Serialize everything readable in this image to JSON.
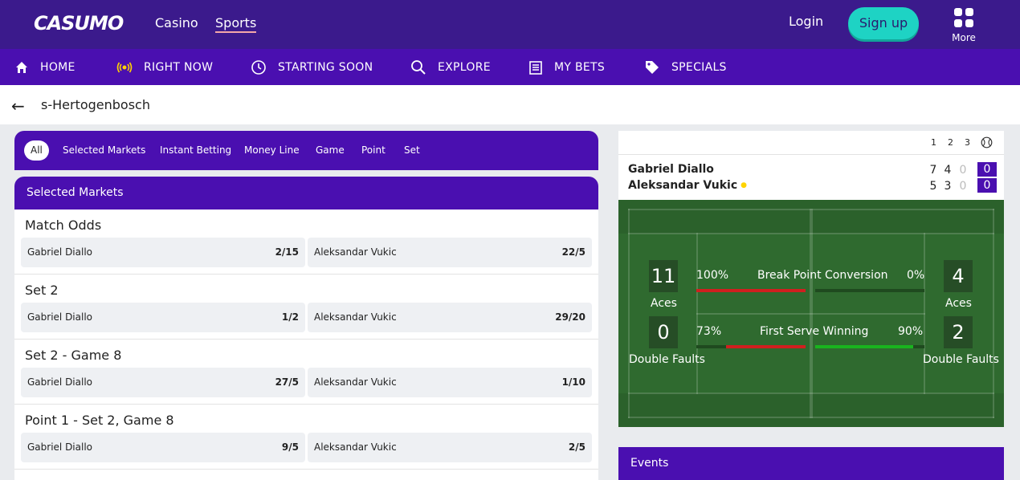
{
  "header": {
    "logo": "CASUMO",
    "nav": [
      "Casino",
      "Sports"
    ],
    "login": "Login",
    "signup": "Sign up",
    "more": "More",
    "brand_color": "#3b1a8c",
    "accent": "#1ed3c4"
  },
  "subnav": {
    "items": [
      {
        "label": "HOME",
        "icon": "home-icon"
      },
      {
        "label": "RIGHT NOW",
        "icon": "live-icon"
      },
      {
        "label": "STARTING SOON",
        "icon": "clock-icon"
      },
      {
        "label": "EXPLORE",
        "icon": "search-icon"
      },
      {
        "label": "MY BETS",
        "icon": "betslip-icon"
      },
      {
        "label": "SPECIALS",
        "icon": "tag-icon"
      }
    ]
  },
  "breadcrumb": {
    "title": "s-Hertogenbosch"
  },
  "filters": [
    "All",
    "Selected Markets",
    "Instant Betting",
    "Money Line",
    "Game",
    "Point",
    "Set"
  ],
  "selected_markets": {
    "header": "Selected Markets",
    "markets": [
      {
        "title": "Match Odds",
        "home": {
          "name": "Gabriel Diallo",
          "odds": "2/15"
        },
        "away": {
          "name": "Aleksandar Vukic",
          "odds": "22/5"
        }
      },
      {
        "title": "Set 2",
        "home": {
          "name": "Gabriel Diallo",
          "odds": "1/2"
        },
        "away": {
          "name": "Aleksandar Vukic",
          "odds": "29/20"
        }
      },
      {
        "title": "Set 2 - Game 8",
        "home": {
          "name": "Gabriel Diallo",
          "odds": "27/5"
        },
        "away": {
          "name": "Aleksandar Vukic",
          "odds": "1/10"
        }
      },
      {
        "title": "Point 1 - Set 2, Game 8",
        "home": {
          "name": "Gabriel Diallo",
          "odds": "9/5"
        },
        "away": {
          "name": "Aleksandar Vukic",
          "odds": "2/5"
        }
      }
    ]
  },
  "scoreboard": {
    "set_headers": [
      "1",
      "2",
      "3"
    ],
    "players": [
      {
        "name": "Gabriel Diallo",
        "sets": [
          "7",
          "4",
          "0"
        ],
        "points": "0"
      },
      {
        "name": "Aleksandar Vukic",
        "sets": [
          "5",
          "3",
          "0"
        ],
        "points": "0",
        "serving": true
      }
    ]
  },
  "stats": {
    "home_aces": "11",
    "away_aces": "4",
    "aces_label": "Aces",
    "home_double_faults": "0",
    "away_double_faults": "2",
    "double_faults_label": "Double Faults",
    "break_point": {
      "label": "Break Point Conversion",
      "home": "100%",
      "away": "0%",
      "home_value": 1.0,
      "away_value": 0.0
    },
    "first_serve": {
      "label": "First Serve Winning",
      "home": "73%",
      "away": "90%",
      "home_value": 0.73,
      "away_value": 0.9
    }
  },
  "events": {
    "header": "Events"
  }
}
